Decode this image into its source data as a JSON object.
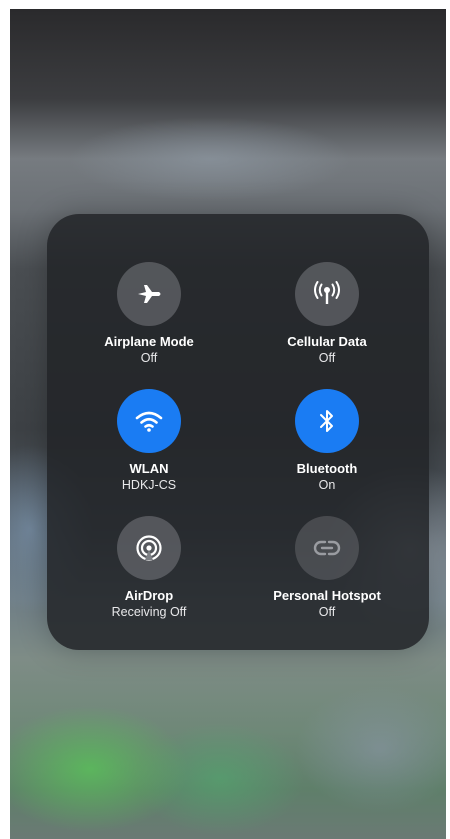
{
  "control_center": {
    "tiles": [
      {
        "label": "Airplane Mode",
        "status": "Off",
        "icon": "airplane-icon",
        "state": "off"
      },
      {
        "label": "Cellular Data",
        "status": "Off",
        "icon": "antenna-icon",
        "state": "off"
      },
      {
        "label": "WLAN",
        "status": "HDKJ-CS",
        "icon": "wifi-icon",
        "state": "on"
      },
      {
        "label": "Bluetooth",
        "status": "On",
        "icon": "bluetooth-icon",
        "state": "on"
      },
      {
        "label": "AirDrop",
        "status": "Receiving Off",
        "icon": "airdrop-icon",
        "state": "off"
      },
      {
        "label": "Personal Hotspot",
        "status": "Off",
        "icon": "hotspot-icon",
        "state": "disabled"
      }
    ]
  },
  "colors": {
    "active": "#1a7cf3",
    "inactive": "#787a80",
    "panel": "#222428"
  }
}
